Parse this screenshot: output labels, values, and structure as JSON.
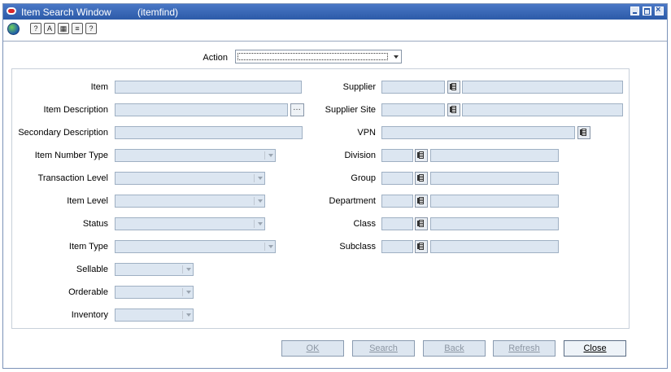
{
  "window": {
    "title": "Item Search Window",
    "subtitle": "(itemfind)"
  },
  "toolbar": {
    "icons": [
      "globe-icon",
      "help-about-icon",
      "spell-check-icon",
      "calculator-icon",
      "print-icon",
      "help-icon"
    ]
  },
  "action": {
    "label": "Action",
    "value": ""
  },
  "left_fields": {
    "item": "Item",
    "item_description": "Item Description",
    "secondary_description": "Secondary Description",
    "item_number_type": "Item Number Type",
    "transaction_level": "Transaction Level",
    "item_level": "Item Level",
    "status": "Status",
    "item_type": "Item Type",
    "sellable": "Sellable",
    "orderable": "Orderable",
    "inventory": "Inventory"
  },
  "right_fields": {
    "supplier": "Supplier",
    "supplier_site": "Supplier Site",
    "vpn": "VPN",
    "division": "Division",
    "group": "Group",
    "department": "Department",
    "class": "Class",
    "subclass": "Subclass"
  },
  "buttons": {
    "ok": "OK",
    "search": "Search",
    "back": "Back",
    "refresh": "Refresh",
    "close": "Close"
  }
}
